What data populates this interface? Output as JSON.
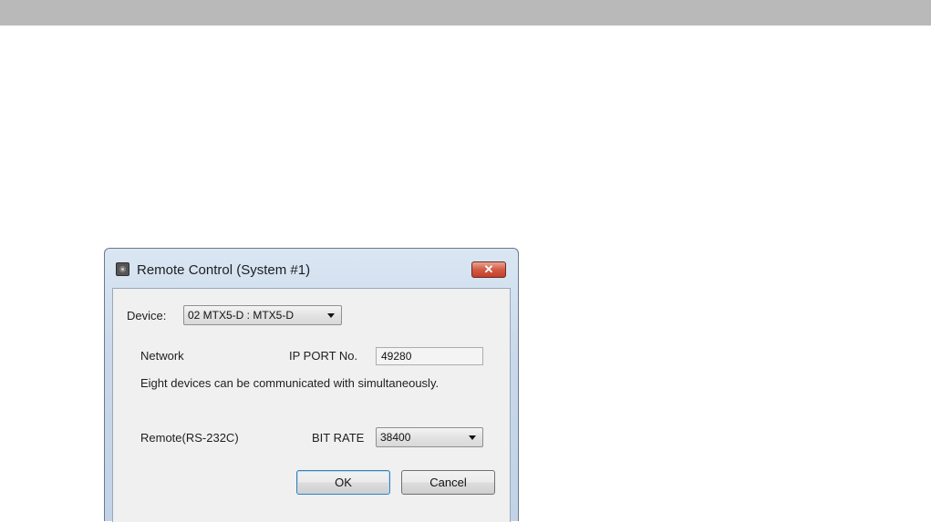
{
  "window": {
    "title": "Remote Control (System #1)",
    "close_icon": "close-icon",
    "close_glyph": "✕"
  },
  "device": {
    "label": "Device:",
    "selected": "02 MTX5-D : MTX5-D"
  },
  "network": {
    "label": "Network",
    "ip_port_label": "IP PORT No.",
    "ip_port_value": "49280",
    "note": "Eight devices can be communicated with simultaneously."
  },
  "remote": {
    "label": "Remote(RS-232C)",
    "bit_rate_label": "BIT RATE",
    "bit_rate_value": "38400"
  },
  "buttons": {
    "ok_label": "OK",
    "cancel_label": "Cancel"
  }
}
